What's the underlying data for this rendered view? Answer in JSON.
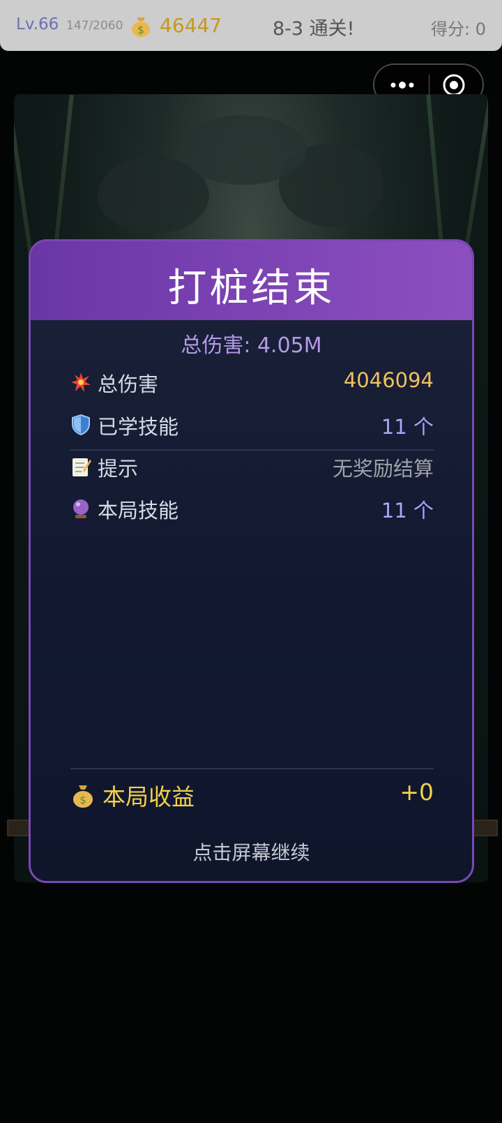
{
  "topbar": {
    "level": "Lv.66",
    "xp": "147/2060",
    "gold": "46447",
    "stage_status": "8-3 通关!",
    "score": "得分: 0"
  },
  "result_panel": {
    "title": "打桩结束",
    "summary": "总伤害: 4.05M",
    "rows": [
      {
        "icon": "explosion-icon",
        "label": "总伤害",
        "value": "4046094"
      },
      {
        "icon": "shield-icon",
        "label": "已学技能",
        "value": "11 个"
      },
      {
        "icon": "memo-icon",
        "label": "提示",
        "value": "无奖励结算"
      },
      {
        "icon": "crystal-ball-icon",
        "label": "本局技能",
        "value": "11 个"
      }
    ],
    "earnings": {
      "icon": "money-bag-icon",
      "label": "本局收益",
      "value": "+0"
    },
    "continue_hint": "点击屏幕继续"
  },
  "colors": {
    "accent_purple": "#7a48b5",
    "gold": "#f0c060",
    "skill_blue": "#a9a5f5"
  }
}
